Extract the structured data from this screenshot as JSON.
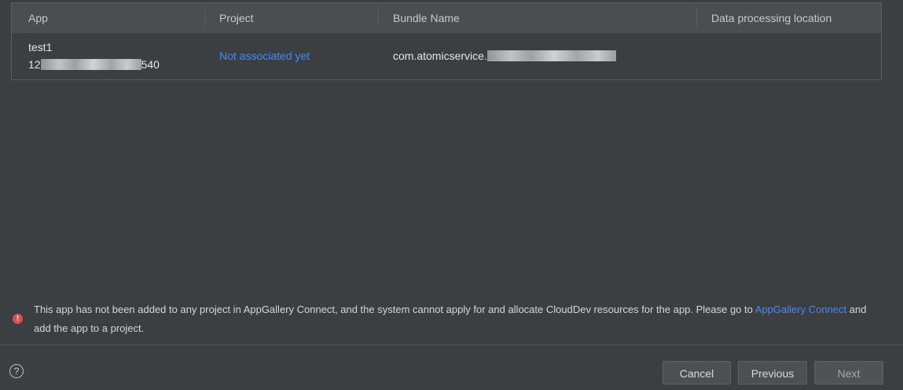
{
  "table": {
    "headers": [
      "App",
      "Project",
      "Bundle Name",
      "Data processing location"
    ],
    "row": {
      "app_name": "test1",
      "app_id_prefix": "12",
      "app_id_suffix": "540",
      "project": "Not associated yet",
      "bundle_prefix": "com.atomicservice.",
      "data_location": ""
    }
  },
  "message": {
    "text_1": "This app has not been added to any project in AppGallery Connect, and the system cannot apply for and allocate CloudDev resources for the app. Please go to ",
    "link": "AppGallery Connect",
    "text_2": " and add the app to a project."
  },
  "footer": {
    "help_icon": "?",
    "cancel_label": "Cancel",
    "previous_label": "Previous",
    "next_label": "Next"
  },
  "colors": {
    "background": "#3c3f41",
    "header": "#4b4e50",
    "link": "#3d8bff",
    "error": "#e04b4b"
  }
}
